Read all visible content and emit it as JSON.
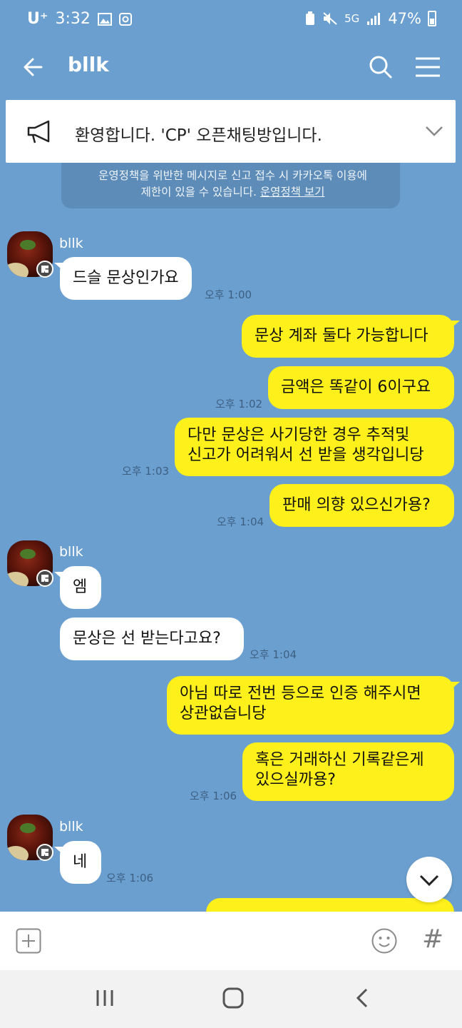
{
  "status_bar": {
    "carrier": "U⁺",
    "time": "3:32",
    "network": "5G",
    "battery": "47%"
  },
  "header": {
    "title": "bllk"
  },
  "notice": {
    "text": "환영합니다. 'CP' 오픈채팅방입니다."
  },
  "policy": {
    "line1": "운영정책을 위반한 메시지로 신고 접수 시 카카오톡 이용에",
    "line2": "제한이 있을 수 있습니다.",
    "link": "운영정책 보기"
  },
  "messages": {
    "g1_sender": "bllk",
    "m1": "드슬 문상인가요",
    "t1": "오후 1:00",
    "m2": "문상 계좌 둘다 가능합니다",
    "m3": "금액은 똑같이 6이구요",
    "t3": "오후 1:02",
    "m4_line1": "다만 문상은 사기당한 경우 추적및",
    "m4_line2": "신고가 어려워서 선 받을 생각입니당",
    "t4": "오후 1:03",
    "m5": "판매 의향 있으신가용?",
    "t5": "오후 1:04",
    "g2_sender": "bllk",
    "m6": "엠",
    "m7": "문상은 선 받는다고요?",
    "t7": "오후 1:04",
    "m8_line1": "아님 따로 전번 등으로 인증 해주시면",
    "m8_line2": "상관없습니당",
    "m9_line1": "혹은 거래하신 기록같은게",
    "m9_line2": "있으실까용?",
    "t9": "오후 1:06",
    "g3_sender": "bllk",
    "m10": "네",
    "t10": "오후 1:06"
  },
  "input": {
    "hash": "#"
  },
  "colors": {
    "chat_background": "#6b9fcf",
    "outgoing_bubble": "#fef01b",
    "incoming_bubble": "#ffffff"
  }
}
